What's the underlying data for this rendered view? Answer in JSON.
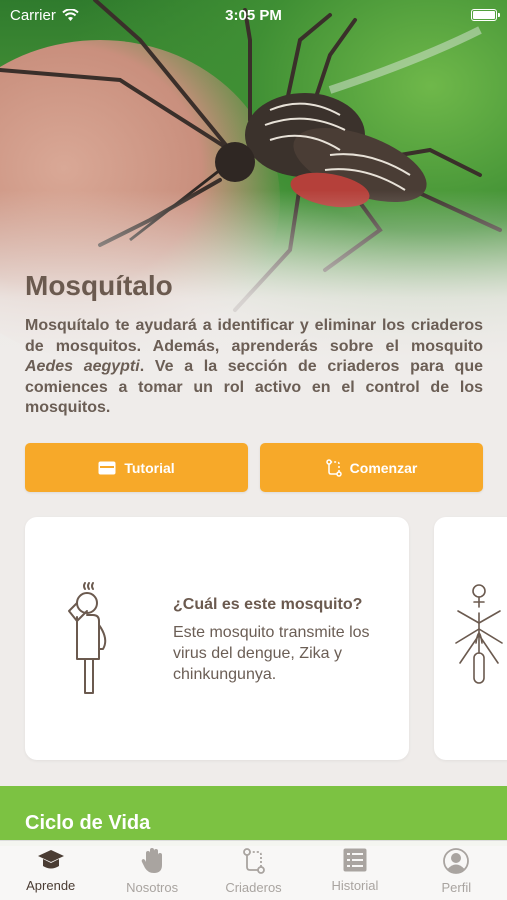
{
  "status_bar": {
    "carrier": "Carrier",
    "time": "3:05 PM"
  },
  "hero": {
    "title": "Mosquítalo",
    "intro_part1": "Mosquítalo te ayudará a identificar y eliminar los criaderos de mosquitos. Además, aprenderás sobre el mosquito ",
    "intro_italic": "Aedes aegypti",
    "intro_part2": ". Ve a la sección de criaderos para que comiences a tomar un rol activo en el control de los mosquitos."
  },
  "buttons": {
    "tutorial_label": "Tutorial",
    "start_label": "Comenzar",
    "color": "#f7a929"
  },
  "cards": [
    {
      "title": "¿Cuál es este mosquito?",
      "text": "Este mosquito transmite los virus del dengue, Zika y chinkungunya.",
      "icon": "person-thinking-icon"
    },
    {
      "icon": "female-mosquito-icon"
    }
  ],
  "section": {
    "title": "Ciclo de Vida",
    "color": "#7cc242"
  },
  "tabs": [
    {
      "label": "Aprende",
      "icon": "graduation-cap-icon",
      "active": true
    },
    {
      "label": "Nosotros",
      "icon": "hand-icon",
      "active": false
    },
    {
      "label": "Criaderos",
      "icon": "route-icon",
      "active": false
    },
    {
      "label": "Historial",
      "icon": "list-icon",
      "active": false
    },
    {
      "label": "Perfil",
      "icon": "profile-icon",
      "active": false
    }
  ]
}
